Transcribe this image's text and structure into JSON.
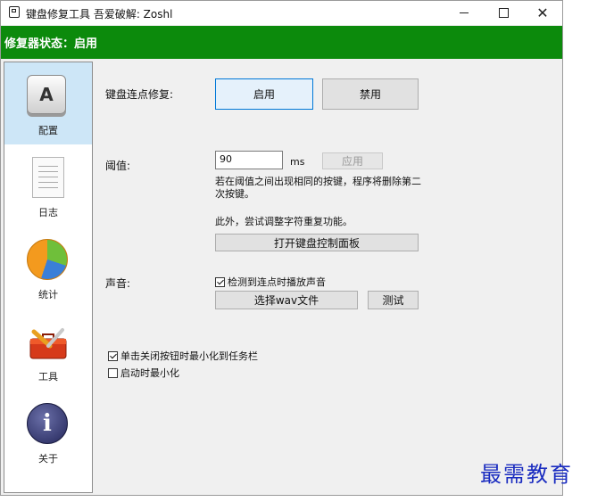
{
  "window": {
    "title": "键盘修复工具 吾爱破解: Zoshl",
    "controls": {
      "minimize": "—",
      "close": "✕"
    }
  },
  "status": {
    "text": "修复器状态：启用",
    "color": "#0c8a0c"
  },
  "sidebar": {
    "items": [
      {
        "label": "配置",
        "icon": "keyboard-key-icon",
        "active": true
      },
      {
        "label": "日志",
        "icon": "document-icon"
      },
      {
        "label": "统计",
        "icon": "pie-chart-icon"
      },
      {
        "label": "工具",
        "icon": "toolbox-icon"
      },
      {
        "label": "关于",
        "icon": "info-icon"
      }
    ]
  },
  "config": {
    "chatter_fix": {
      "label": "键盘连点修复:",
      "enable_label": "启用",
      "disable_label": "禁用"
    },
    "threshold": {
      "label": "阈值:",
      "value": "90",
      "unit": "ms",
      "apply_label": "应用",
      "description": "若在阈值之间出现相同的按键，程序将删除第二次按键。"
    },
    "extra": {
      "note": "此外，尝试调整字符重复功能。",
      "open_panel_label": "打开键盘控制面板"
    },
    "sound": {
      "label": "声音:",
      "play_sound_label": "检测到连点时播放声音",
      "play_sound_checked": true,
      "choose_wav_label": "选择wav文件",
      "test_label": "测试"
    },
    "options": {
      "minimize_on_close_label": "单击关闭按钮时最小化到任务栏",
      "minimize_on_close_checked": true,
      "start_minimized_label": "启动时最小化",
      "start_minimized_checked": false
    }
  },
  "watermark": "最需教育"
}
